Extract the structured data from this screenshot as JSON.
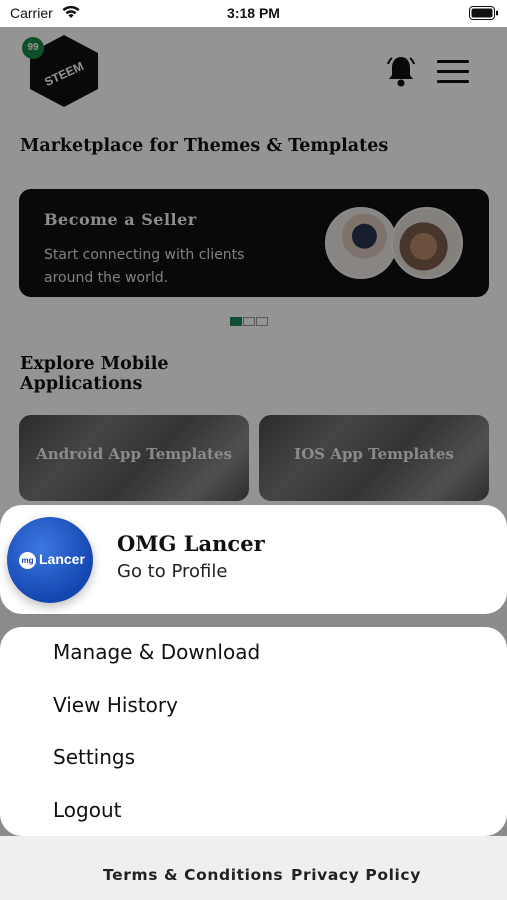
{
  "status_bar": {
    "carrier": "Carrier",
    "time": "3:18 PM"
  },
  "header": {
    "logo_text": "STEEM",
    "logo_badge": "99",
    "bell_icon": "bell-icon",
    "menu_icon": "hamburger-menu-icon"
  },
  "marketplace": {
    "title": "Marketplace for Themes & Templates"
  },
  "seller_banner": {
    "title": "Become a Seller",
    "subtitle": "Start connecting with clients around the world."
  },
  "carousel": {
    "pages": 3,
    "active_index": 0
  },
  "explore": {
    "title": "Explore Mobile Applications",
    "tiles": [
      {
        "label": "Android App Templates"
      },
      {
        "label": "IOS App Templates"
      }
    ]
  },
  "profile": {
    "avatar_text": "Lancer",
    "avatar_mark": "mg",
    "name": "OMG Lancer",
    "link": "Go to Profile"
  },
  "menu": {
    "items": [
      "Manage & Download",
      "View History",
      "Settings",
      "Logout"
    ]
  },
  "footer": {
    "terms": "Terms & Conditions",
    "privacy": "Privacy Policy"
  },
  "colors": {
    "accent_green": "#1a8a5a",
    "avatar_blue": "#1446b0",
    "overlay": "rgba(0,0,0,0.42)"
  }
}
